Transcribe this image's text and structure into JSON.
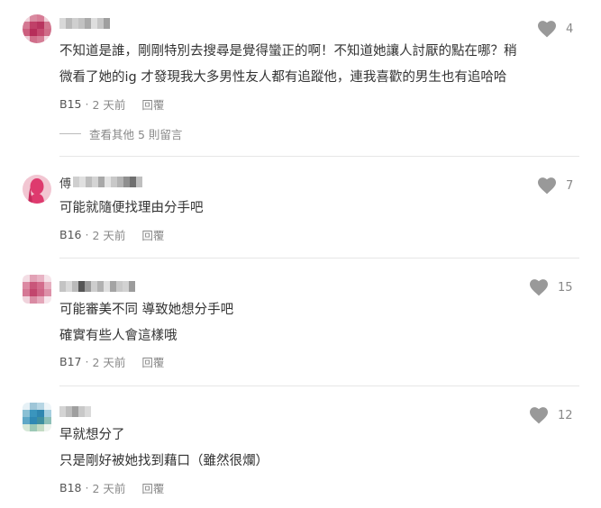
{
  "comments": [
    {
      "like_count": "4",
      "lines": [
        "不知道是誰，剛剛特別去搜尋是覺得蠻正的啊！不知道她讓人討厭的點在哪？稍",
        "微看了她的ig 才發現我大多男性友人都有追蹤他，連我喜歡的男生也有追哈哈"
      ],
      "floor": "B15",
      "time": "2 天前",
      "reply_label": "回覆",
      "more_replies": "查看其他 5 則留言"
    },
    {
      "name_initial": "傅",
      "like_count": "7",
      "lines": [
        "可能就隨便找理由分手吧"
      ],
      "floor": "B16",
      "time": "2 天前",
      "reply_label": "回覆"
    },
    {
      "like_count": "15",
      "lines": [
        "可能審美不同 導致她想分手吧",
        "確實有些人會這樣哦"
      ],
      "floor": "B17",
      "time": "2 天前",
      "reply_label": "回覆"
    },
    {
      "like_count": "12",
      "lines": [
        "早就想分了",
        "只是剛好被她找到藉口（雖然很爛）"
      ],
      "floor": "B18",
      "time": "2 天前",
      "reply_label": "回覆"
    }
  ],
  "meta_separator": "·",
  "colors": {
    "heart": "#999999",
    "text": "#333333",
    "muted": "#888888"
  },
  "icons": {
    "like": "heart-icon",
    "avatar": "pixelated-avatar"
  }
}
